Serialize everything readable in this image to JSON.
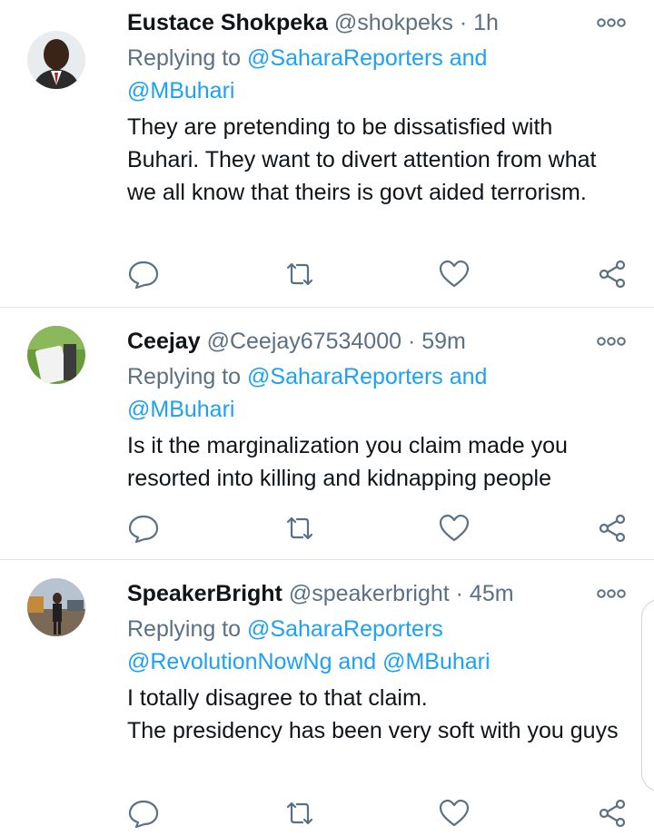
{
  "tweets": [
    {
      "name": "Eustace Shokpeka",
      "handle": "@shokpeks",
      "time": "1h",
      "replying_prefix": "Replying to ",
      "replying_line1_link": "@SaharaReporters and",
      "replying_line2_link": "@MBuhari",
      "text": "They are pretending to be dissatisfied with Buhari. They want to divert attention from what we all know that theirs is govt aided terrorism."
    },
    {
      "name": "Ceejay",
      "handle": "@Ceejay67534000",
      "time": "59m",
      "replying_prefix": "Replying to ",
      "replying_line1_link": "@SaharaReporters and",
      "replying_line2_link": "@MBuhari",
      "text": "Is it the marginalization you claim made you resorted into killing and kidnapping people"
    },
    {
      "name": "SpeakerBright",
      "handle": "@speakerbright",
      "time": "45m",
      "replying_prefix": "Replying to ",
      "replying_line1_link": "@SaharaReporters",
      "replying_line2_link": "@RevolutionNowNg and @MBuhari",
      "text": "I totally disagree to that claim.\nThe presidency has been very soft with you guys"
    }
  ],
  "separator": " · ",
  "colors": {
    "link": "#1da1f2",
    "muted": "#5b7083",
    "text": "#0f1419"
  },
  "icons": [
    "reply-icon",
    "retweet-icon",
    "like-icon",
    "share-icon",
    "more-icon"
  ]
}
